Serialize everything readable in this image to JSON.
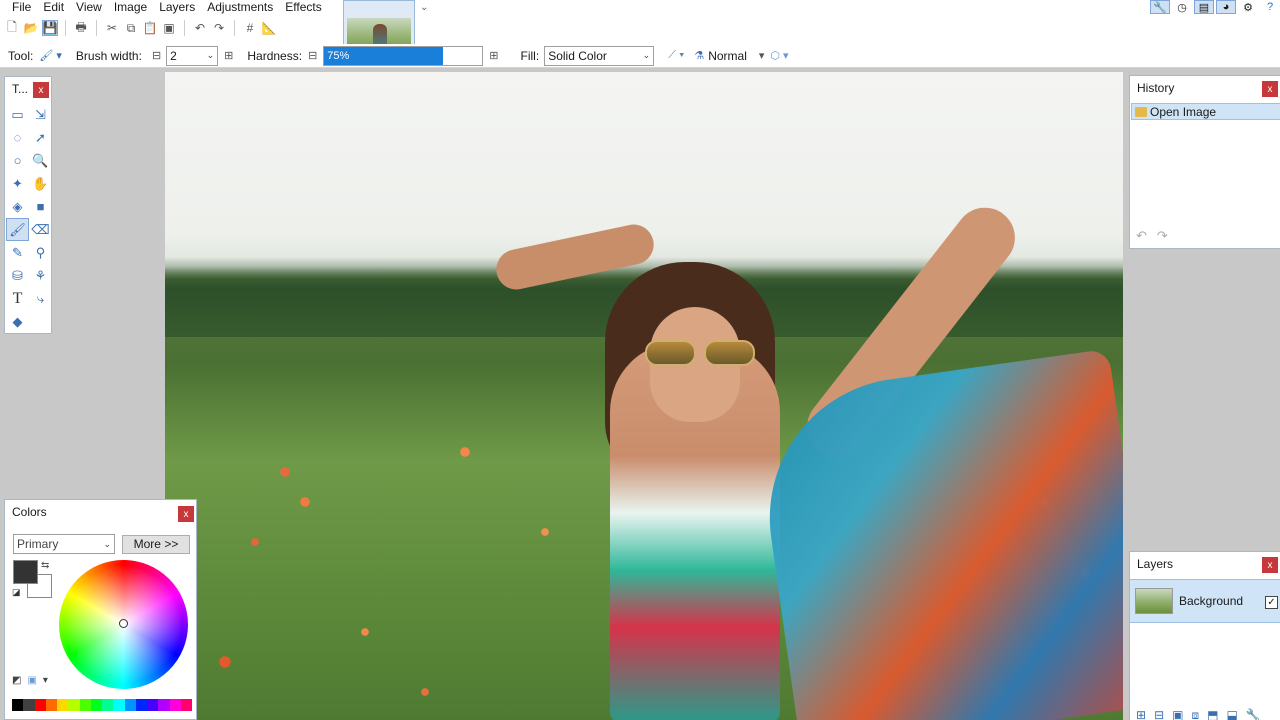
{
  "menu": [
    "File",
    "Edit",
    "View",
    "Image",
    "Layers",
    "Adjustments",
    "Effects"
  ],
  "options": {
    "tool_label": "Tool:",
    "brush_width_label": "Brush width:",
    "brush_width_value": "2",
    "hardness_label": "Hardness:",
    "hardness_value": "75%",
    "hardness_fraction": 0.75,
    "fill_label": "Fill:",
    "fill_value": "Solid Color",
    "blend_mode": "Normal",
    "minus": "⊟",
    "plus": "⊞"
  },
  "tools_panel": {
    "title": "T...",
    "close": "x"
  },
  "history_panel": {
    "title": "History",
    "close": "x",
    "items": [
      "Open Image"
    ]
  },
  "layers_panel": {
    "title": "Layers",
    "close": "x",
    "layer_name": "Background",
    "checked": "✓"
  },
  "colors_panel": {
    "title": "Colors",
    "close": "x",
    "mode": "Primary",
    "more_label": "More >>",
    "primary_color": "#333333",
    "secondary_color": "#ffffff"
  },
  "accent_color": "#1a7fd8"
}
